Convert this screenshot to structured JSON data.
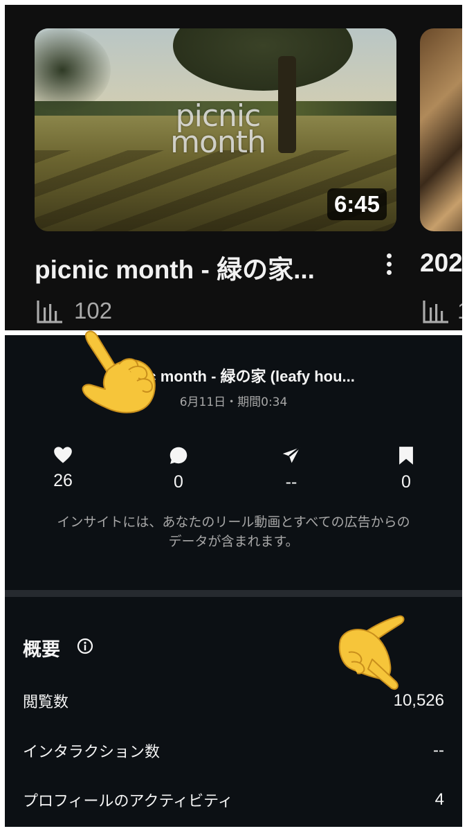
{
  "youtube_panel": {
    "thumbnail_overlay_text": [
      "picnic",
      "month"
    ],
    "duration": "6:45",
    "video_title": "picnic month - 緑の家...",
    "view_count": "102",
    "next_video_title": "202",
    "next_view_count": "1"
  },
  "insights_panel": {
    "reel_title": "picnic month - 緑の家 (leafy hou...",
    "reel_meta": "6月11日・期間0:34",
    "metrics": [
      {
        "icon": "heart-icon",
        "value": "26"
      },
      {
        "icon": "comment-icon",
        "value": "0"
      },
      {
        "icon": "share-icon",
        "value": "--"
      },
      {
        "icon": "bookmark-icon",
        "value": "0"
      }
    ],
    "notice_lines": [
      "インサイトには、あなたのリール動画とすべての広告からの",
      "データが含まれます。"
    ],
    "overview": {
      "heading": "概要",
      "rows": [
        {
          "label": "閲覧数",
          "value": "10,526"
        },
        {
          "label": "インタラクション数",
          "value": "--"
        },
        {
          "label": "プロフィールのアクティビティ",
          "value": "4"
        }
      ]
    }
  },
  "colors": {
    "youtube_bg": "#0f0f0f",
    "insights_bg": "#0c1014",
    "text_primary": "#f5f5f5",
    "text_secondary": "#a8a8a8",
    "hand_emoji": "#f6c53a"
  }
}
